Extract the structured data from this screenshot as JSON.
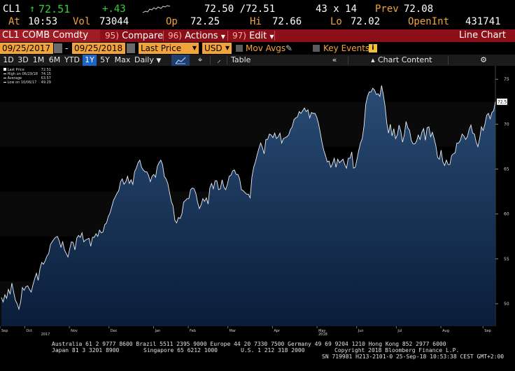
{
  "quote": {
    "ticker": "CL1",
    "arrow": "↑",
    "last": "72.51",
    "change": "+.43",
    "bid_ask": "72.50 /72.51",
    "size": "43 x 14",
    "prev_label": "Prev",
    "prev": "72.08",
    "at_label": "At",
    "time": "10:53",
    "vol_label": "Vol",
    "vol": "73044",
    "op_label": "Op",
    "op": "72.25",
    "hi_label": "Hi",
    "hi": "72.66",
    "lo_label": "Lo",
    "lo": "72.02",
    "oi_label": "OpenInt",
    "oi": "431741"
  },
  "titlebar": {
    "security": "CL1 COMB Comdty",
    "compare_num": "95)",
    "compare": "Compare",
    "actions_num": "96)",
    "actions": "Actions",
    "edit_num": "97)",
    "edit": "Edit",
    "chart_type": "Line Chart"
  },
  "settings": {
    "start_date": "09/25/2017",
    "dash": "-",
    "end_date": "09/25/2018",
    "field": "Last Price",
    "currency": "USD",
    "mov_avgs": "Mov Avgs",
    "key_events": "Key Events"
  },
  "toolbar": {
    "periods": [
      "1D",
      "3D",
      "1M",
      "6M",
      "YTD",
      "1Y",
      "5Y",
      "Max"
    ],
    "active_period": "1Y",
    "frequency": "Daily",
    "table": "Table",
    "chart_content": "Chart Content"
  },
  "chart_data": {
    "type": "area",
    "y_ticks": [
      50,
      55,
      60,
      65,
      70,
      75
    ],
    "ylim": [
      47.5,
      76.5
    ],
    "last_price_tag": "72.51",
    "x_labels": [
      {
        "label": "Sep",
        "pos": 0.0
      },
      {
        "label": "Oct",
        "pos": 0.05
      },
      {
        "label": "2017",
        "pos": 0.08
      },
      {
        "label": "Nov",
        "pos": 0.14
      },
      {
        "label": "Dec",
        "pos": 0.22
      },
      {
        "label": "Jan",
        "pos": 0.31
      },
      {
        "label": "Feb",
        "pos": 0.38
      },
      {
        "label": "Mar",
        "pos": 0.46
      },
      {
        "label": "Apr",
        "pos": 0.55
      },
      {
        "label": "May",
        "pos": 0.64
      },
      {
        "label": "2018",
        "pos": 0.64
      },
      {
        "label": "Jun",
        "pos": 0.72
      },
      {
        "label": "Jul",
        "pos": 0.8
      },
      {
        "label": "Aug",
        "pos": 0.89
      },
      {
        "label": "Sep",
        "pos": 0.975
      }
    ],
    "legend": [
      {
        "label": "Last Price",
        "value": "72.51"
      },
      {
        "label": "High on 06/29/18",
        "value": "74.15"
      },
      {
        "label": "Average",
        "value": "63.57"
      },
      {
        "label": "Low on 10/06/17",
        "value": "49.29"
      }
    ],
    "series": [
      {
        "values": [
          50.7,
          50.2,
          51.0,
          50.6,
          51.6,
          51.1,
          52.3,
          51.3,
          50.4,
          50.0,
          49.4,
          50.2,
          51.8,
          51.5,
          51.9,
          52.0,
          51.6,
          51.3,
          52.1,
          52.8,
          53.4,
          52.6,
          53.9,
          54.6,
          54.4,
          54.8,
          55.3,
          55.6,
          56.6,
          56.9,
          57.2,
          57.4,
          57.5,
          57.0,
          56.3,
          56.9,
          56.0,
          55.6,
          55.2,
          56.1,
          56.9,
          56.8,
          56.0,
          57.3,
          57.6,
          57.4,
          57.9,
          56.9,
          57.1,
          57.2,
          57.3,
          56.4,
          57.4,
          57.4,
          57.8,
          57.5,
          58.2,
          57.9,
          58.0,
          58.8,
          59.0,
          59.7,
          60.1,
          60.8,
          61.5,
          61.9,
          62.3,
          62.6,
          63.6,
          63.9,
          63.3,
          63.6,
          64.2,
          63.4,
          63.8,
          63.3,
          64.7,
          65.1,
          65.7,
          66.0,
          65.2,
          64.9,
          64.7,
          64.7,
          64.3,
          63.6,
          64.2,
          64.4,
          64.1,
          65.3,
          65.7,
          66.0,
          65.5,
          64.2,
          63.9,
          63.4,
          62.4,
          61.4,
          60.9,
          59.3,
          59.0,
          59.6,
          59.5,
          60.0,
          61.3,
          61.5,
          61.7,
          61.7,
          62.7,
          62.9,
          62.8,
          62.3,
          61.3,
          60.6,
          61.0,
          61.7,
          61.4,
          61.8,
          61.1,
          62.9,
          63.4,
          62.8,
          63.7,
          63.7,
          62.7,
          62.8,
          63.8,
          63.0,
          62.7,
          63.3,
          64.2,
          64.3,
          64.8,
          64.9,
          64.4,
          64.4,
          63.9,
          62.7,
          62.6,
          62.4,
          62.2,
          62.2,
          61.8,
          64.1,
          65.2,
          65.8,
          66.6,
          67.3,
          67.9,
          67.4,
          66.7,
          68.3,
          68.3,
          68.9,
          68.8,
          68.5,
          69.0,
          68.4,
          68.6,
          69.0,
          67.9,
          68.4,
          68.5,
          68.6,
          68.8,
          69.4,
          69.7,
          70.5,
          70.7,
          70.8,
          71.4,
          71.2,
          71.5,
          71.8,
          71.4,
          71.6,
          70.7,
          71.3,
          71.2,
          71.2,
          70.8,
          70.1,
          69.1,
          68.0,
          67.1,
          66.5,
          65.8,
          65.9,
          65.2,
          65.6,
          66.2,
          65.2,
          66.1,
          65.7,
          65.9,
          66.1,
          65.5,
          65.1,
          66.2,
          66.2,
          66.9,
          65.1,
          65.2,
          66.1,
          67.1,
          67.9,
          68.4,
          69.8,
          72.2,
          73.1,
          73.6,
          73.6,
          74.0,
          73.8,
          73.3,
          73.4,
          73.1,
          74.3,
          73.3,
          72.0,
          70.1,
          69.0,
          70.0,
          68.7,
          69.5,
          68.4,
          68.8,
          69.9,
          69.2,
          68.0,
          68.8,
          70.3,
          69.6,
          69.3,
          68.2,
          67.8,
          67.8,
          68.1,
          68.8,
          68.3,
          69.1,
          69.5,
          68.2,
          69.6,
          69.7,
          68.6,
          69.1,
          68.4,
          67.6,
          66.3,
          66.1,
          67.1,
          65.8,
          65.4,
          66.0,
          65.5,
          65.5,
          66.5,
          66.7,
          66.8,
          67.9,
          67.9,
          68.2,
          68.9,
          68.7,
          68.3,
          68.6,
          69.4,
          69.9,
          69.0,
          68.9,
          68.0,
          67.5,
          68.4,
          69.7,
          69.3,
          70.0,
          71.0,
          71.2,
          70.6,
          71.3,
          71.5,
          72.5
        ]
      }
    ]
  },
  "footer": {
    "line1": "Australia 61 2 9777 8600 Brazil 5511 2395 9000 Europe 44 20 7330 7500 Germany 49 69 9204 1210 Hong Kong 852 2977 6000",
    "line2a": "Japan 81 3 3201 8900",
    "line2b": "Singapore 65 6212 1000",
    "line2c": "U.S. 1 212 318 2000",
    "line2d": "Copyright 2018 Bloomberg Finance L.P.",
    "line3": "SN 719981 H213-2101-0 25-Sep-18 10:53:38 CEST GMT+2:00"
  }
}
